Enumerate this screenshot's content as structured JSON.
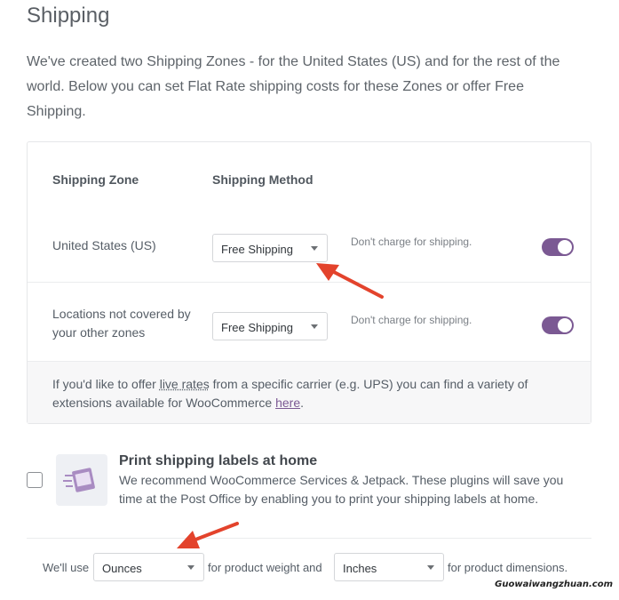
{
  "page": {
    "title": "Shipping",
    "intro": "We've created two Shipping Zones - for the United States (US) and for the rest of the world. Below you can set Flat Rate shipping costs for these Zones or offer Free Shipping."
  },
  "zones_table": {
    "headers": {
      "zone": "Shipping Zone",
      "method": "Shipping Method"
    },
    "rows": [
      {
        "zone": "United States (US)",
        "method": "Free Shipping",
        "description": "Don't charge for shipping.",
        "enabled": true
      },
      {
        "zone": "Locations not covered by your other zones",
        "method": "Free Shipping",
        "description": "Don't charge for shipping.",
        "enabled": true
      }
    ],
    "footer": {
      "text_before": "If you'd like to offer ",
      "live_rates": "live rates",
      "text_middle": " from a specific carrier (e.g. UPS) you can find a variety of extensions available for WooCommerce ",
      "here_link": "here",
      "text_after": "."
    }
  },
  "print_labels": {
    "title": "Print shipping labels at home",
    "description": "We recommend WooCommerce Services & Jetpack. These plugins will save you time at the Post Office by enabling you to print your shipping labels at home.",
    "checked": false
  },
  "units": {
    "prefix": "We'll use",
    "weight_value": "Ounces",
    "weight_suffix": "for product weight and",
    "dimension_value": "Inches",
    "dimension_suffix": "for product dimensions."
  },
  "watermark": "Guowaiwangzhuan.com",
  "colors": {
    "accent": "#7b5993",
    "arrow": "#e3432c"
  }
}
